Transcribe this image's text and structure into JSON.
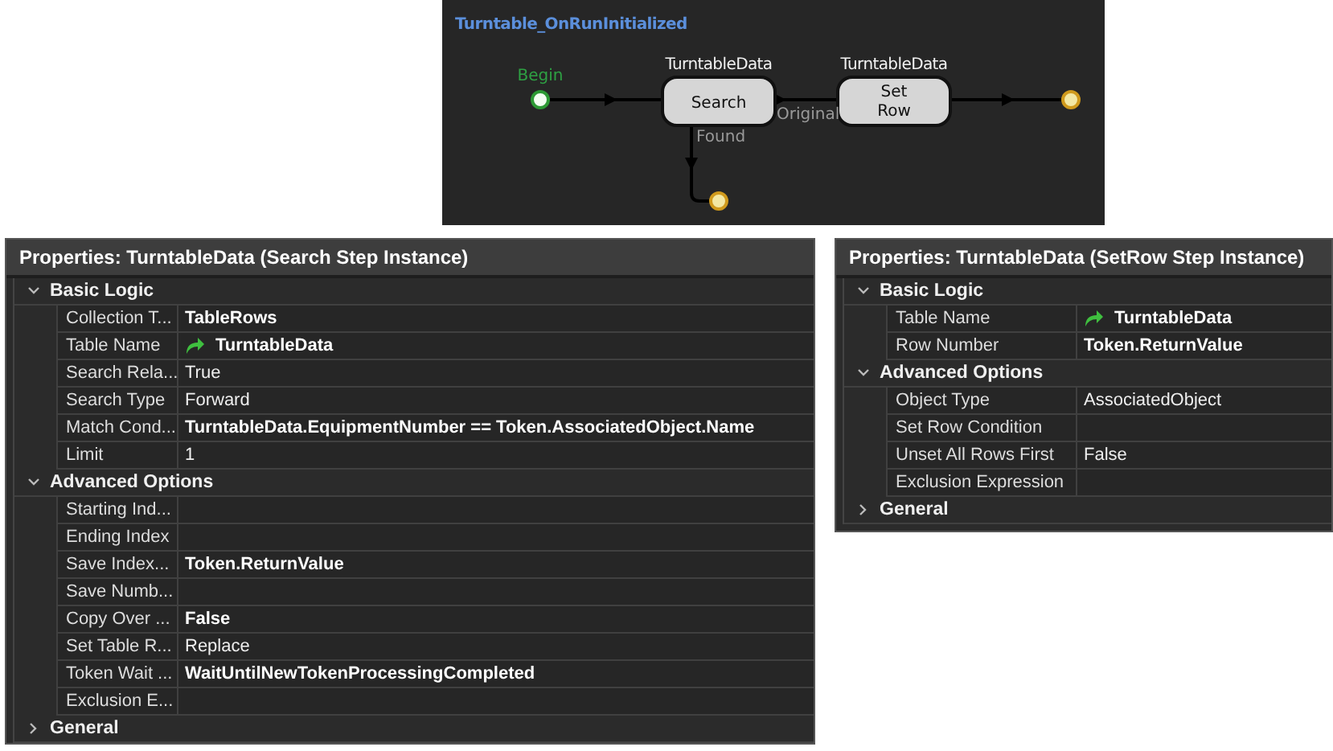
{
  "diagram": {
    "title": "Turntable_OnRunInitialized",
    "start": {
      "label": "Begin"
    },
    "steps": [
      {
        "caption": "TurntableData",
        "label": "Search"
      },
      {
        "caption": "TurntableData",
        "label": "Set Row"
      }
    ],
    "links": [
      {
        "label": "Original"
      },
      {
        "label": "Found"
      }
    ]
  },
  "panels": [
    {
      "title": "Properties: TurntableData (Search Step Instance)",
      "categories": [
        {
          "label": "Basic Logic",
          "expanded": true,
          "properties": [
            {
              "name": "Collection T...",
              "value": "TableRows",
              "bold": true
            },
            {
              "name": "Table Name",
              "value": "TurntableData",
              "bold": true,
              "kind": "reference"
            },
            {
              "name": "Search Rela...",
              "value": "True",
              "bold": false
            },
            {
              "name": "Search Type",
              "value": "Forward",
              "bold": false
            },
            {
              "name": "Match Cond...",
              "value": "TurntableData.EquipmentNumber == Token.AssociatedObject.Name",
              "bold": true
            },
            {
              "name": "Limit",
              "value": "1",
              "bold": false
            }
          ]
        },
        {
          "label": "Advanced Options",
          "expanded": true,
          "properties": [
            {
              "name": "Starting Ind..."
            },
            {
              "name": "Ending Index"
            },
            {
              "name": "Save Index...",
              "value": "Token.ReturnValue",
              "bold": true
            },
            {
              "name": "Save Numb..."
            },
            {
              "name": "Copy Over ...",
              "value": "False",
              "bold": true
            },
            {
              "name": "Set Table R...",
              "value": "Replace",
              "bold": false
            },
            {
              "name": "Token Wait ...",
              "value": "WaitUntilNewTokenProcessingCompleted",
              "bold": true
            },
            {
              "name": "Exclusion E..."
            }
          ]
        },
        {
          "label": "General",
          "expanded": false
        }
      ]
    },
    {
      "title": "Properties: TurntableData (SetRow Step Instance)",
      "categories": [
        {
          "label": "Basic Logic",
          "expanded": true,
          "properties": [
            {
              "name": "Table Name",
              "value": "TurntableData",
              "bold": true,
              "kind": "reference"
            },
            {
              "name": "Row Number",
              "value": "Token.ReturnValue",
              "bold": true
            }
          ]
        },
        {
          "label": "Advanced Options",
          "expanded": true,
          "properties": [
            {
              "name": "Object Type",
              "value": "AssociatedObject",
              "bold": false
            },
            {
              "name": "Set Row Condition"
            },
            {
              "name": "Unset All Rows First",
              "value": "False",
              "bold": false
            },
            {
              "name": "Exclusion Expression"
            }
          ]
        },
        {
          "label": "General",
          "expanded": false
        }
      ]
    }
  ]
}
